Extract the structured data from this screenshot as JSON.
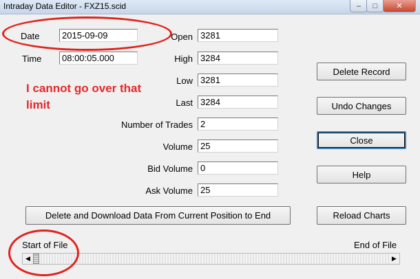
{
  "window": {
    "title": "Intraday Data Editor - FXZ15.scid",
    "minimize_glyph": "–",
    "maximize_glyph": "□",
    "close_glyph": "✕"
  },
  "fields": {
    "date": {
      "label": "Date",
      "value": "2015-09-09"
    },
    "time": {
      "label": "Time",
      "value": "08:00:05.000"
    },
    "open": {
      "label": "Open",
      "value": "3281"
    },
    "high": {
      "label": "High",
      "value": "3284"
    },
    "low": {
      "label": "Low",
      "value": "3281"
    },
    "last": {
      "label": "Last",
      "value": "3284"
    },
    "number_of_trades": {
      "label": "Number of Trades",
      "value": "2"
    },
    "volume": {
      "label": "Volume",
      "value": "25"
    },
    "bid_volume": {
      "label": "Bid Volume",
      "value": "0"
    },
    "ask_volume": {
      "label": "Ask Volume",
      "value": "25"
    }
  },
  "buttons": {
    "delete_record": "Delete  Record",
    "undo_changes": "Undo Changes",
    "close": "Close",
    "help": "Help",
    "delete_download": "Delete and Download Data From Current Position to End",
    "reload_charts": "Reload Charts"
  },
  "navigation": {
    "start_label": "Start of File",
    "end_label": "End of File",
    "left_arrow": "◀",
    "right_arrow": "▶",
    "position_fraction": 0.0
  },
  "annotation": {
    "text_line1": "I cannot go over that",
    "text_line2": "limit",
    "color": "#e5282a"
  }
}
